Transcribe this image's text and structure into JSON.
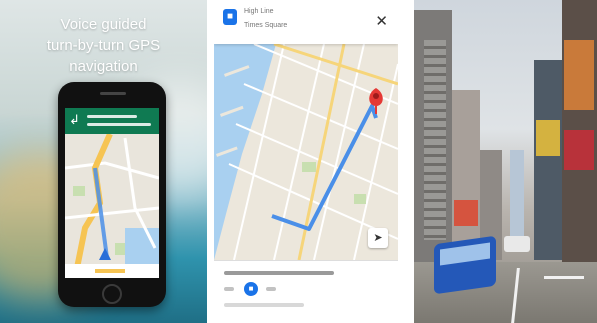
{
  "promo": {
    "title_line1": "Voice guided",
    "title_line2": "turn-by-turn GPS",
    "title_line3": "navigation"
  },
  "directions": {
    "from_label": "High Line",
    "to_label": "Times Square"
  },
  "colors": {
    "route_blue": "#4a8fe8",
    "pin_red": "#e53935",
    "nav_green": "#0f7a52",
    "water_blue": "#a9d0f0"
  },
  "icons": [
    "transit-icon",
    "close-icon",
    "compass-icon",
    "turn-arrow-icon",
    "destination-pin-icon",
    "home-button-icon"
  ]
}
